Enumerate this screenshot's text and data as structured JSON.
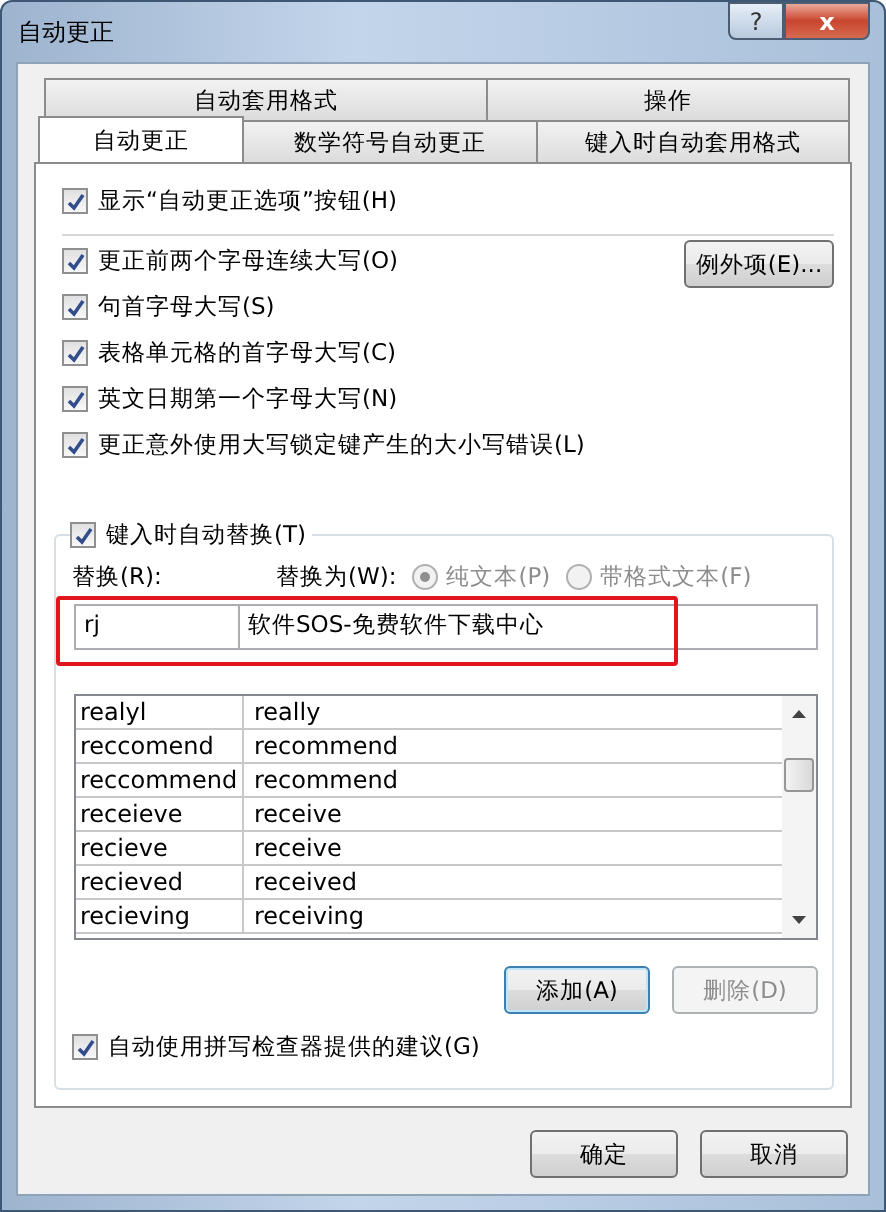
{
  "window": {
    "title": "自动更正",
    "help": "?",
    "close": "x"
  },
  "tab_rows": [
    [
      {
        "label": "自动套用格式",
        "selected": false
      },
      {
        "label": "操作",
        "selected": false
      }
    ],
    [
      {
        "label": "自动更正",
        "selected": true
      },
      {
        "label": "数学符号自动更正",
        "selected": false
      },
      {
        "label": "键入时自动套用格式",
        "selected": false
      }
    ]
  ],
  "show_button_option": {
    "label": "显示“自动更正选项”按钮(H)",
    "checked": true
  },
  "options": [
    {
      "label": "更正前两个字母连续大写(O)",
      "checked": true
    },
    {
      "label": "句首字母大写(S)",
      "checked": true
    },
    {
      "label": "表格单元格的首字母大写(C)",
      "checked": true
    },
    {
      "label": "英文日期第一个字母大写(N)",
      "checked": true
    },
    {
      "label": "更正意外使用大写锁定键产生的大小写错误(L)",
      "checked": true
    }
  ],
  "exceptions_button": "例外项(E)...",
  "replace_group": {
    "label": "键入时自动替换(T)",
    "checked": true,
    "replace_label": "替换(R):",
    "with_label": "替换为(W):",
    "formats": [
      {
        "label": "纯文本(P)",
        "selected": true,
        "disabled": true
      },
      {
        "label": "带格式文本(F)",
        "selected": false,
        "disabled": true
      }
    ],
    "replace_value": "rj",
    "with_value": "软件SOS-免费软件下载中心",
    "rows": [
      {
        "from": "realyl",
        "to": "really"
      },
      {
        "from": "reccomend",
        "to": "recommend"
      },
      {
        "from": "reccommend",
        "to": "recommend"
      },
      {
        "from": "receieve",
        "to": "receive"
      },
      {
        "from": "recieve",
        "to": "receive"
      },
      {
        "from": "recieved",
        "to": "received"
      },
      {
        "from": "recieving",
        "to": "receiving"
      }
    ],
    "buttons": [
      {
        "label": "添加(A)",
        "disabled": false,
        "default": true
      },
      {
        "label": "删除(D)",
        "disabled": true,
        "default": false
      }
    ],
    "spellcheck": {
      "label": "自动使用拼写检查器提供的建议(G)",
      "checked": true
    }
  },
  "dialog_buttons": [
    "确定",
    "取消"
  ]
}
